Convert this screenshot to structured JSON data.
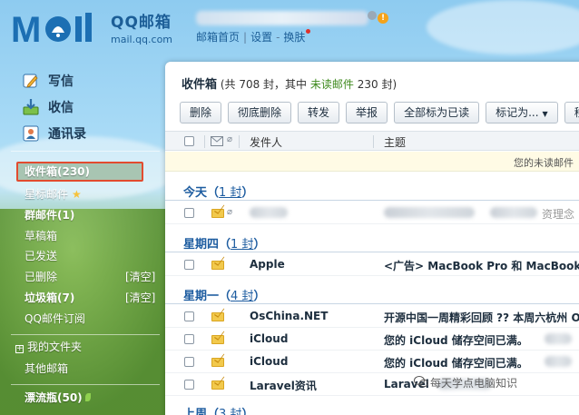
{
  "header": {
    "brand_title": "QQ邮箱",
    "brand_url": "mail.qq.com",
    "links": [
      "邮箱首页",
      "设置",
      "换肤"
    ]
  },
  "sidebar": {
    "actions": [
      {
        "label": "写信",
        "icon": "pencil-icon"
      },
      {
        "label": "收信",
        "icon": "inbox-download-icon"
      },
      {
        "label": "通讯录",
        "icon": "contacts-icon"
      }
    ],
    "folders": {
      "inbox": "收件箱(230)",
      "starred": "星标邮件",
      "group": "群邮件(1)",
      "drafts": "草稿箱",
      "sent": "已发送",
      "deleted": "已删除",
      "spam": "垃圾箱(7)",
      "subscriptions": "QQ邮件订阅",
      "my_folders": "我的文件夹",
      "other": "其他邮箱",
      "drift": "漂流瓶(50)"
    },
    "clear_label": "[清空]"
  },
  "main": {
    "title": "收件箱",
    "summary_prefix": "(共 708 封，其中",
    "unread_label": "未读邮件",
    "summary_suffix": "230 封)",
    "toolbar": [
      "删除",
      "彻底删除",
      "转发",
      "举报",
      "全部标为已读",
      "标记为...",
      "移"
    ],
    "columns": {
      "sender": "发件人",
      "subject": "主题"
    },
    "notice": "您的未读邮件",
    "groups": [
      {
        "label": "今天",
        "count": "1 封"
      },
      {
        "label": "星期四",
        "count": "1 封"
      },
      {
        "label": "星期一",
        "count": "4 封"
      },
      {
        "label": "上周",
        "count": "3 封"
      }
    ],
    "rows": [
      {
        "sender": "",
        "subject": "",
        "tail": "资理念"
      },
      {
        "sender": "Apple",
        "subject": "<广告> MacBook Pro 和 MacBook"
      },
      {
        "sender": "OsChina.NET",
        "subject": "开源中国一周精彩回顾 ?? 本周六杭州 O"
      },
      {
        "sender": "iCloud",
        "subject": "您的 iCloud 储存空间已满。"
      },
      {
        "sender": "iCloud",
        "subject": "您的 iCloud 储存空间已满。"
      },
      {
        "sender": "Laravel资讯",
        "subject": "Laravel"
      }
    ]
  },
  "watermark": "每天学点电脑知识",
  "colors": {
    "accent": "#1d5ca0",
    "unread": "#3f8a1e",
    "selection": "#e24b2f"
  }
}
